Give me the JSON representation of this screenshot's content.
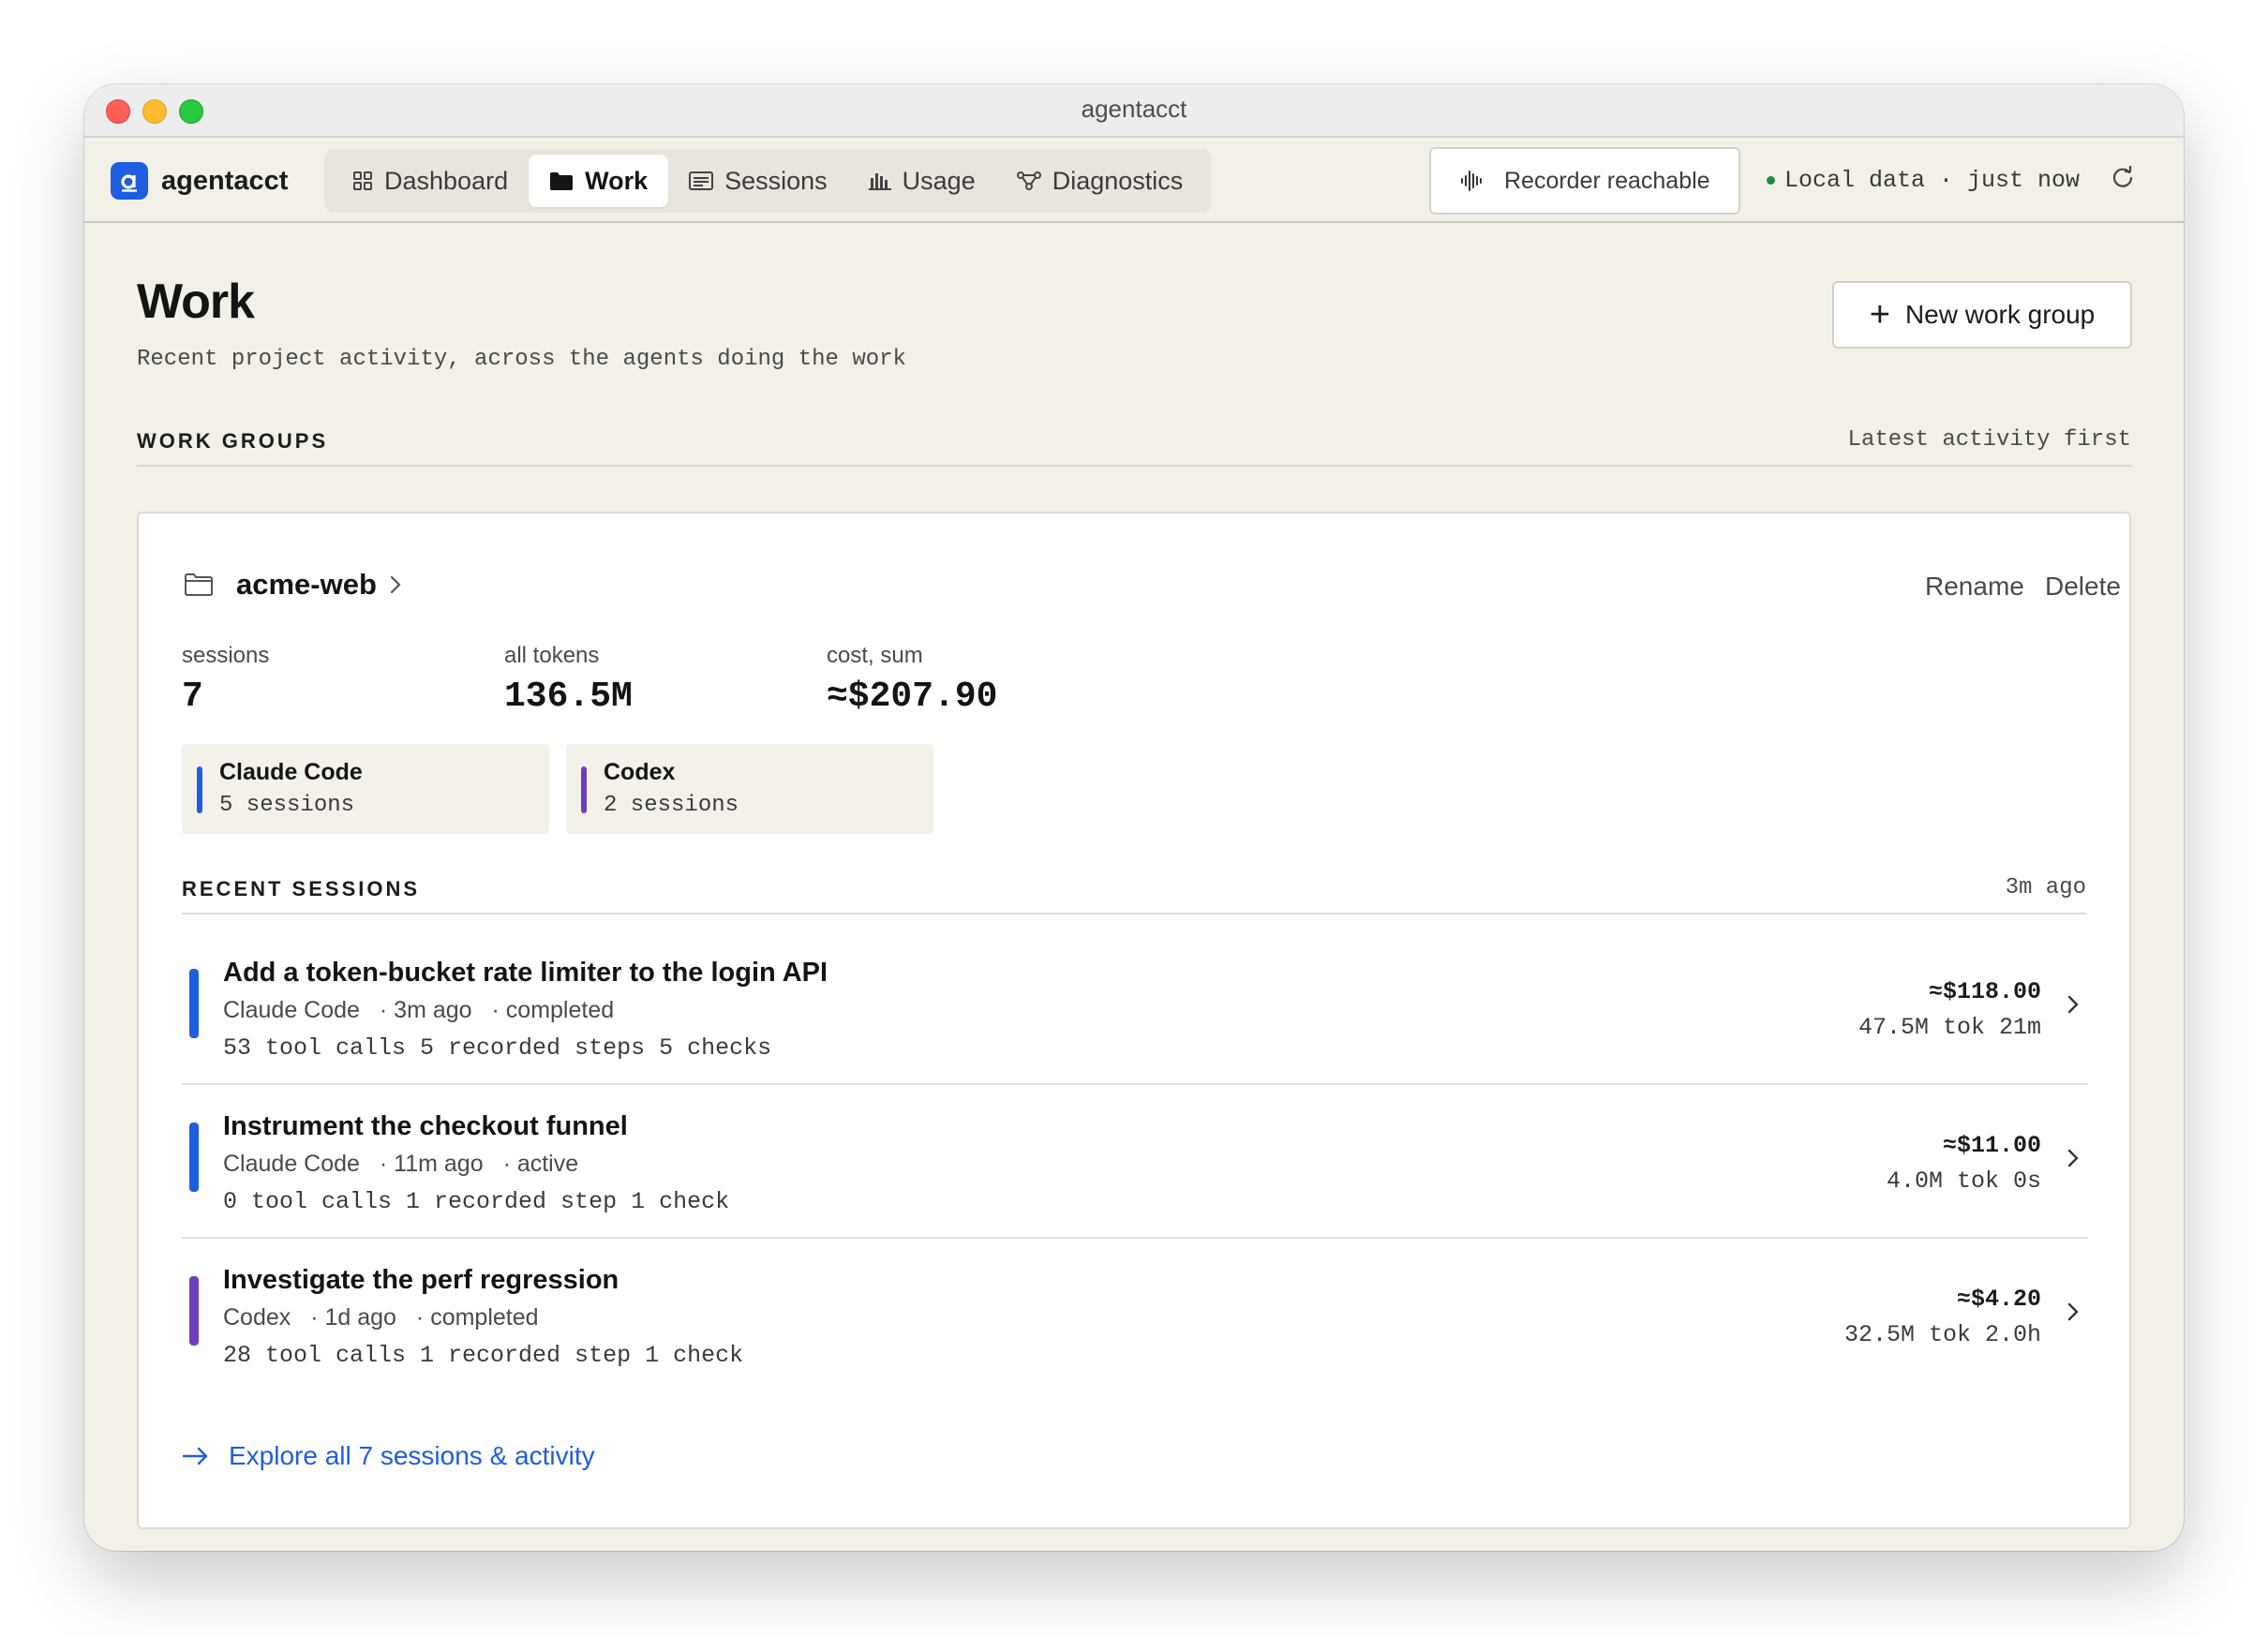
{
  "window": {
    "title": "agentacct"
  },
  "brand": {
    "name": "agentacct"
  },
  "nav": {
    "tabs": [
      {
        "label": "Dashboard",
        "icon": "grid-icon"
      },
      {
        "label": "Work",
        "icon": "folder-icon",
        "active": true
      },
      {
        "label": "Sessions",
        "icon": "list-icon"
      },
      {
        "label": "Usage",
        "icon": "bar-chart-icon"
      },
      {
        "label": "Diagnostics",
        "icon": "nodes-icon"
      }
    ],
    "recorder": "Recorder reachable",
    "local_data": "Local data · just now"
  },
  "page": {
    "title": "Work",
    "subtitle": "Recent project activity, across the agents doing the work",
    "new_button": "New work group",
    "section_label": "WORK GROUPS",
    "section_sort": "Latest activity first"
  },
  "group": {
    "name": "acme-web",
    "rename": "Rename",
    "delete": "Delete",
    "stats": [
      {
        "label": "sessions",
        "value": "7"
      },
      {
        "label": "all tokens",
        "value": "136.5M"
      },
      {
        "label": "cost, sum",
        "value": "≈$207.90"
      }
    ],
    "agents": [
      {
        "name": "Claude Code",
        "count": "5 sessions",
        "color": "#1f5de0"
      },
      {
        "name": "Codex",
        "count": "2 sessions",
        "color": "#6d3fc0"
      }
    ],
    "recent_label": "RECENT SESSIONS",
    "recent_time": "3m ago",
    "sessions": [
      {
        "title": "Add a token-bucket rate limiter to the login API",
        "agent": "Claude Code",
        "when": "· 3m ago",
        "status": "· completed",
        "stats": "53 tool calls 5 recorded steps 5 checks",
        "cost": "≈$118.00",
        "tokens": "47.5M tok 21m",
        "color": "#1f5de0"
      },
      {
        "title": "Instrument the checkout funnel",
        "agent": "Claude Code",
        "when": "· 11m ago",
        "status": "· active",
        "stats": "0 tool calls 1 recorded step 1 check",
        "cost": "≈$11.00",
        "tokens": "4.0M tok 0s",
        "color": "#1f5de0"
      },
      {
        "title": "Investigate the perf regression",
        "agent": "Codex",
        "when": "· 1d ago",
        "status": "· completed",
        "stats": "28 tool calls 1 recorded step 1 check",
        "cost": "≈$4.20",
        "tokens": "32.5M tok 2.0h",
        "color": "#6d3fc0"
      }
    ],
    "explore": "Explore all 7 sessions & activity"
  }
}
